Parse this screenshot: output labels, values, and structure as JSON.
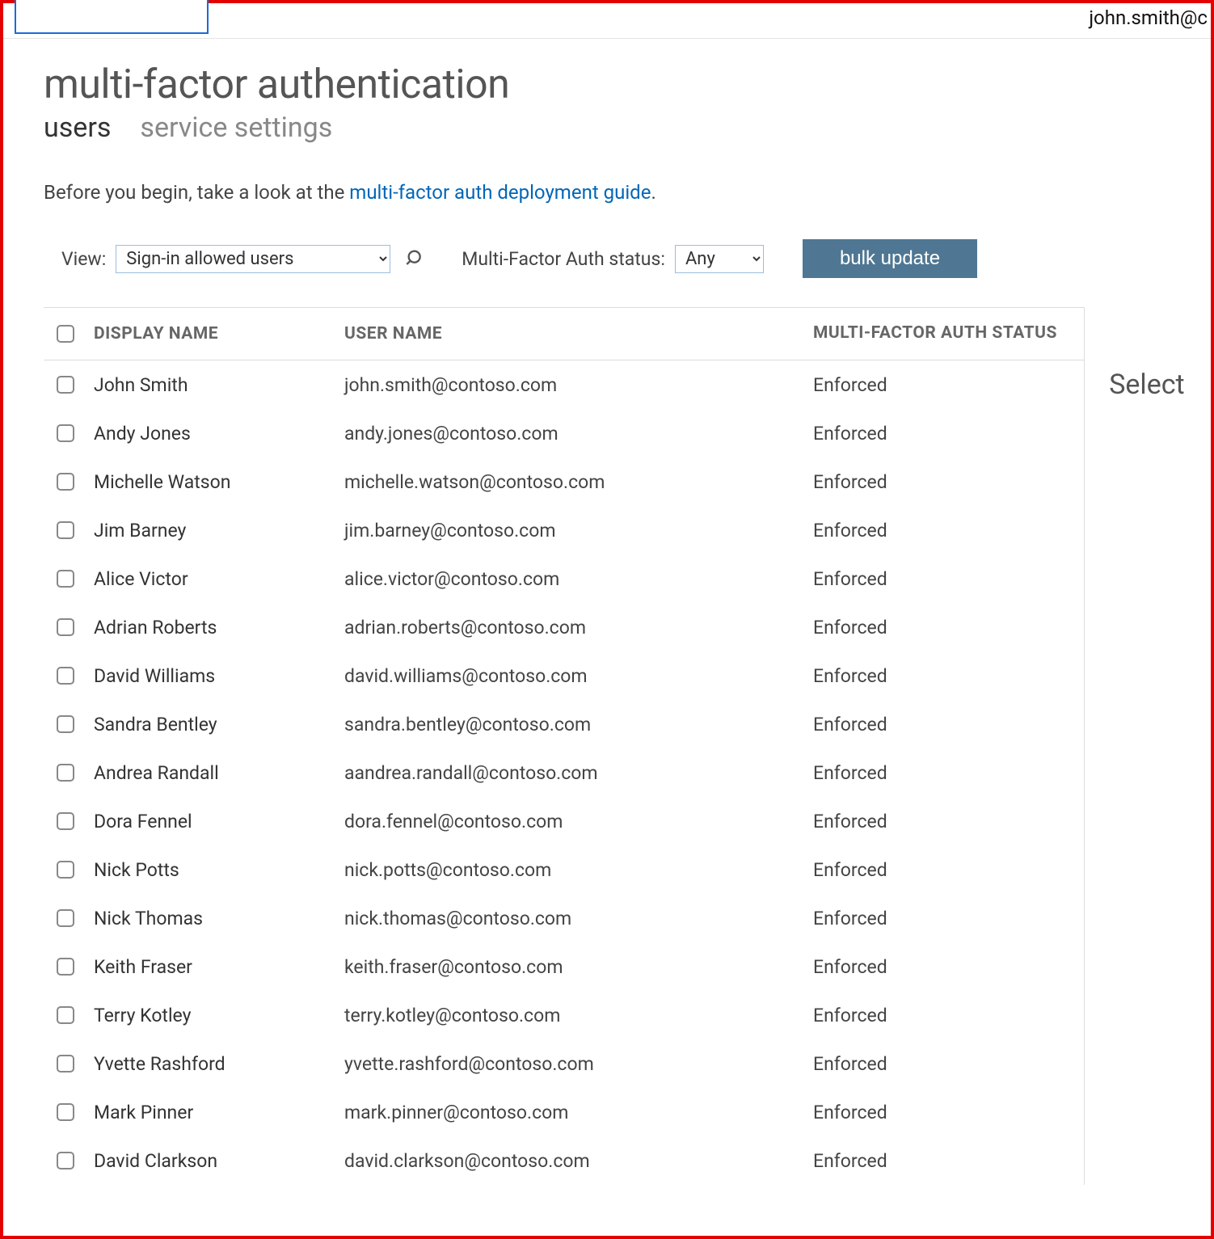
{
  "header": {
    "signed_in_user": "john.smith@c"
  },
  "page": {
    "title": "multi-factor authentication",
    "intro_prefix": "Before you begin, take a look at the ",
    "intro_link_text": "multi-factor auth deployment guide",
    "intro_suffix": "."
  },
  "tabs": {
    "users": "users",
    "service_settings": "service settings"
  },
  "filters": {
    "view_label": "View:",
    "view_value": "Sign-in allowed users",
    "status_label": "Multi-Factor Auth status:",
    "status_value": "Any",
    "bulk_update_label": "bulk update"
  },
  "columns": {
    "display_name": "DISPLAY NAME",
    "user_name": "USER NAME",
    "mfa_status": "MULTI-FACTOR AUTH STATUS"
  },
  "right_pane": {
    "heading": "Select"
  },
  "rows": [
    {
      "display_name": "John Smith",
      "user_name": "john.smith@contoso.com",
      "status": "Enforced"
    },
    {
      "display_name": "Andy Jones",
      "user_name": "andy.jones@contoso.com",
      "status": "Enforced"
    },
    {
      "display_name": "Michelle Watson",
      "user_name": "michelle.watson@contoso.com",
      "status": "Enforced"
    },
    {
      "display_name": "Jim Barney",
      "user_name": "jim.barney@contoso.com",
      "status": "Enforced"
    },
    {
      "display_name": "Alice Victor",
      "user_name": "alice.victor@contoso.com",
      "status": "Enforced"
    },
    {
      "display_name": "Adrian Roberts",
      "user_name": "adrian.roberts@contoso.com",
      "status": "Enforced"
    },
    {
      "display_name": "David Williams",
      "user_name": "david.williams@contoso.com",
      "status": "Enforced"
    },
    {
      "display_name": "Sandra Bentley",
      "user_name": "sandra.bentley@contoso.com",
      "status": "Enforced"
    },
    {
      "display_name": "Andrea Randall",
      "user_name": "aandrea.randall@contoso.com",
      "status": "Enforced"
    },
    {
      "display_name": "Dora Fennel",
      "user_name": "dora.fennel@contoso.com",
      "status": "Enforced"
    },
    {
      "display_name": "Nick Potts",
      "user_name": "nick.potts@contoso.com",
      "status": "Enforced"
    },
    {
      "display_name": "Nick Thomas",
      "user_name": "nick.thomas@contoso.com",
      "status": "Enforced"
    },
    {
      "display_name": "Keith Fraser",
      "user_name": "keith.fraser@contoso.com",
      "status": "Enforced"
    },
    {
      "display_name": "Terry Kotley",
      "user_name": "terry.kotley@contoso.com",
      "status": "Enforced"
    },
    {
      "display_name": "Yvette Rashford",
      "user_name": "yvette.rashford@contoso.com",
      "status": "Enforced"
    },
    {
      "display_name": "Mark Pinner",
      "user_name": "mark.pinner@contoso.com",
      "status": "Enforced"
    },
    {
      "display_name": "David Clarkson",
      "user_name": "david.clarkson@contoso.com",
      "status": "Enforced"
    }
  ]
}
